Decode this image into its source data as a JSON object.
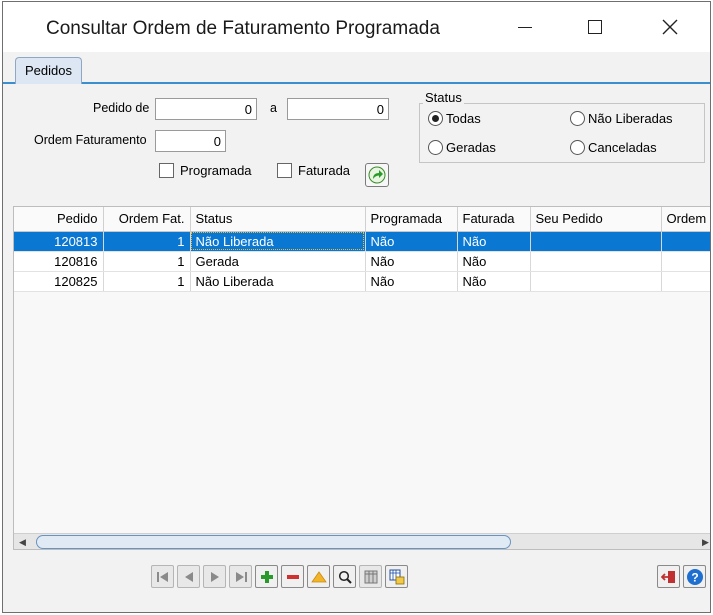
{
  "window": {
    "title": "Consultar Ordem de Faturamento Programada"
  },
  "tabs": [
    {
      "label": "Pedidos",
      "active": true
    }
  ],
  "filters": {
    "pedido_de_label": "Pedido de",
    "pedido_de_value": "0",
    "pedido_a_label": "a",
    "pedido_a_value": "0",
    "ordem_label": "Ordem Faturamento",
    "ordem_value": "0",
    "programada_label": "Programada",
    "programada_checked": false,
    "faturada_label": "Faturada",
    "faturada_checked": false
  },
  "status": {
    "legend": "Status",
    "options": [
      {
        "label": "Todas",
        "selected": true
      },
      {
        "label": "Não Liberadas",
        "selected": false
      },
      {
        "label": "Geradas",
        "selected": false
      },
      {
        "label": "Canceladas",
        "selected": false
      }
    ]
  },
  "grid": {
    "columns": [
      "Pedido",
      "Ordem Fat.",
      "Status",
      "Programada",
      "Faturada",
      "Seu Pedido",
      "Ordem"
    ],
    "rows": [
      {
        "pedido": "120813",
        "ordem": "1",
        "status": "Não Liberada",
        "programada": "Não",
        "faturada": "Não",
        "seu_pedido": "",
        "ordem2": "",
        "selected": true
      },
      {
        "pedido": "120816",
        "ordem": "1",
        "status": "Gerada",
        "programada": "Não",
        "faturada": "Não",
        "seu_pedido": "",
        "ordem2": "",
        "selected": false
      },
      {
        "pedido": "120825",
        "ordem": "1",
        "status": "Não Liberada",
        "programada": "Não",
        "faturada": "Não",
        "seu_pedido": "",
        "ordem2": "",
        "selected": false
      }
    ]
  },
  "colors": {
    "selection": "#0a78d2",
    "tab_accent": "#3b8fcf",
    "add_green": "#2a9a2a",
    "remove_red": "#d03030",
    "help_blue": "#1f6fd0"
  },
  "navigator": {
    "icons": [
      "first-record-icon",
      "prior-record-icon",
      "next-record-icon",
      "last-record-icon",
      "insert-record-icon",
      "delete-record-icon",
      "edit-record-icon",
      "search-icon",
      "grid-columns-icon",
      "export-icon"
    ]
  },
  "footer": {
    "icons": [
      "exit-icon",
      "help-icon"
    ]
  }
}
